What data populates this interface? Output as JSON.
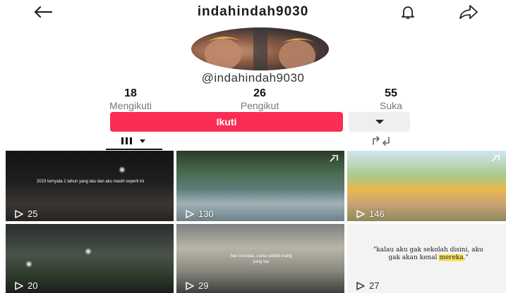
{
  "header": {
    "username": "indahindah9030"
  },
  "profile": {
    "handle": "@indahindah9030"
  },
  "stats": {
    "following": {
      "value": "18",
      "label": "Mengikuti"
    },
    "followers": {
      "value": "26",
      "label": "Pengikut"
    },
    "likes": {
      "value": "55",
      "label": "Suka"
    }
  },
  "actions": {
    "follow_label": "Ikuti"
  },
  "videos": [
    {
      "views": "25",
      "caption": "2023 ternyata 1 tahun yang lalu dan aku masih seperti ini"
    },
    {
      "views": "130"
    },
    {
      "views": "146"
    },
    {
      "views": "20"
    },
    {
      "views": "29",
      "caption": "hari ini lukas, cuma sedikit orang yang tau"
    },
    {
      "views": "27",
      "quote_before": "\"kalau aku gak sekolah disini, aku gak akan kenal ",
      "quote_highlight": "mereka",
      "quote_after": ".\""
    }
  ],
  "colors": {
    "accent": "#fb2c55",
    "secondary_button": "#efefef",
    "highlight": "#f7e35b"
  },
  "icons": [
    "back-arrow",
    "bell",
    "share-arrow",
    "chevron-down",
    "grid",
    "repost",
    "play",
    "pin"
  ]
}
